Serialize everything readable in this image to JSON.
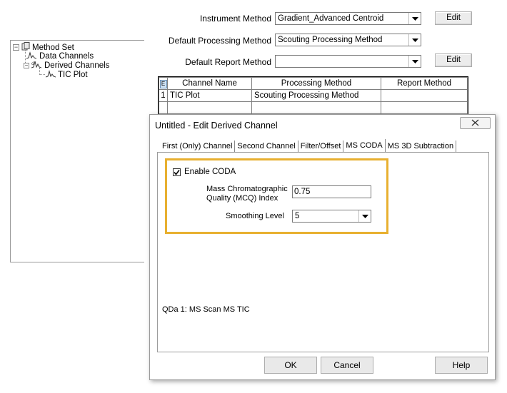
{
  "form": {
    "instrument_method": {
      "label": "Instrument Method",
      "value": "Gradient_Advanced Centroid",
      "button": "Edit"
    },
    "processing_method": {
      "label": "Default Processing Method",
      "value": "Scouting Processing Method"
    },
    "report_method": {
      "label": "Default Report Method",
      "value": "",
      "button": "Edit"
    }
  },
  "tree": {
    "root": "Method Set",
    "items": [
      {
        "label": "Data Channels"
      },
      {
        "label": "Derived Channels"
      },
      {
        "label": "TIC Plot"
      }
    ]
  },
  "grid": {
    "corner": "E",
    "headers": [
      "Channel Name",
      "Processing Method",
      "Report Method"
    ],
    "rows": [
      {
        "num": "1",
        "channel": "TIC Plot",
        "processing": "Scouting Processing Method",
        "report": ""
      }
    ]
  },
  "dialog": {
    "title": "Untitled - Edit Derived Channel",
    "tabs": [
      "First (Only) Channel",
      "Second Channel",
      "Filter/Offset",
      "MS CODA",
      "MS 3D Subtraction"
    ],
    "active_tab": "MS CODA",
    "enable_coda": {
      "label": "Enable CODA",
      "checked": true
    },
    "mcq": {
      "label_line1": "Mass Chromatographic",
      "label_line2": "Quality (MCQ) Index",
      "value": "0.75"
    },
    "smoothing": {
      "label": "Smoothing Level",
      "value": "5"
    },
    "source": "QDa 1: MS Scan MS TIC",
    "buttons": {
      "ok": "OK",
      "cancel": "Cancel",
      "help": "Help"
    }
  },
  "colors": {
    "highlight": "#e8b030"
  }
}
